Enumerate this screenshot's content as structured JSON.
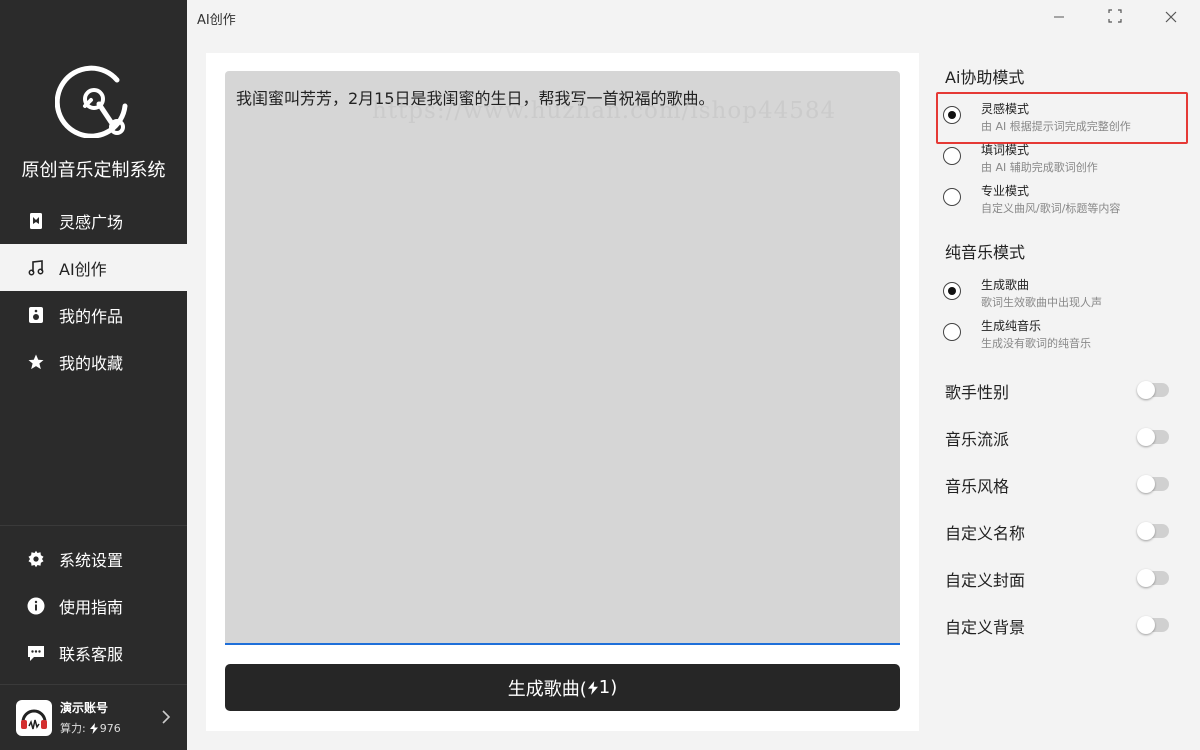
{
  "window": {
    "title": "AI创作"
  },
  "app": {
    "name": "原创音乐定制系统"
  },
  "nav": {
    "items": [
      {
        "label": "灵感广场",
        "icon": "bookmark-icon"
      },
      {
        "label": "AI创作",
        "icon": "music-note-icon",
        "active": true
      },
      {
        "label": "我的作品",
        "icon": "speaker-icon"
      },
      {
        "label": "我的收藏",
        "icon": "star-icon"
      }
    ],
    "bottom": [
      {
        "label": "系统设置",
        "icon": "gear-icon"
      },
      {
        "label": "使用指南",
        "icon": "info-icon"
      },
      {
        "label": "联系客服",
        "icon": "chat-icon"
      }
    ]
  },
  "account": {
    "name": "演示账号",
    "power_label": "算力:",
    "power_value": "976"
  },
  "prompt": {
    "value": "我闺蜜叫芳芳，2月15日是我闺蜜的生日，帮我写一首祝福的歌曲。"
  },
  "watermark": "https://www.huzhan.com/ishop44584",
  "generate": {
    "label": "生成歌曲(",
    "cost": "1",
    "suffix": ")"
  },
  "assist_mode": {
    "title": "Ai协助模式",
    "options": [
      {
        "label": "灵感模式",
        "desc": "由 AI 根据提示词完成完整创作",
        "checked": true
      },
      {
        "label": "填词模式",
        "desc": "由 AI 辅助完成歌词创作",
        "checked": false
      },
      {
        "label": "专业模式",
        "desc": "自定义曲风/歌词/标题等内容",
        "checked": false
      }
    ]
  },
  "pure_mode": {
    "title": "纯音乐模式",
    "options": [
      {
        "label": "生成歌曲",
        "desc": "歌词生效歌曲中出现人声",
        "checked": true
      },
      {
        "label": "生成纯音乐",
        "desc": "生成没有歌词的纯音乐",
        "checked": false
      }
    ]
  },
  "toggles": [
    {
      "label": "歌手性别",
      "on": false
    },
    {
      "label": "音乐流派",
      "on": false
    },
    {
      "label": "音乐风格",
      "on": false
    },
    {
      "label": "自定义名称",
      "on": false
    },
    {
      "label": "自定义封面",
      "on": false
    },
    {
      "label": "自定义背景",
      "on": false
    }
  ],
  "colors": {
    "sidebar": "#2b2b2b",
    "accent": "#1e6fd9",
    "highlight": "#e53935",
    "button": "#262626"
  }
}
